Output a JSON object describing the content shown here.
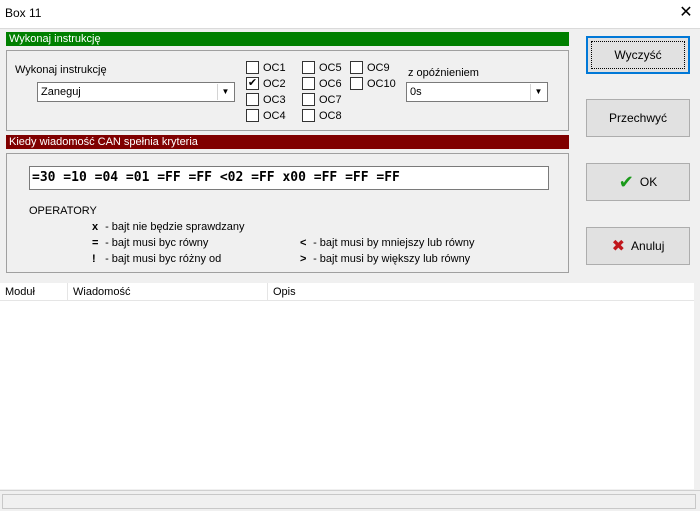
{
  "window": {
    "title": "Box 11"
  },
  "execute_section": {
    "header": "Wykonaj instrukcję",
    "instruction_label": "Wykonaj instrukcję",
    "instruction_value": "Zaneguj",
    "oc_columns": [
      [
        {
          "label": "OC1",
          "checked": false
        },
        {
          "label": "OC2",
          "checked": true
        },
        {
          "label": "OC3",
          "checked": false
        },
        {
          "label": "OC4",
          "checked": false
        }
      ],
      [
        {
          "label": "OC5",
          "checked": false
        },
        {
          "label": "OC6",
          "checked": false
        },
        {
          "label": "OC7",
          "checked": false
        },
        {
          "label": "OC8",
          "checked": false
        }
      ],
      [
        {
          "label": "OC9",
          "checked": false
        },
        {
          "label": "OC10",
          "checked": false
        }
      ]
    ],
    "delay_label": "z opóźnieniem",
    "delay_value": "0s"
  },
  "criteria_section": {
    "header": "Kiedy wiadomość CAN spełnia kryteria",
    "criteria": "=30 =10 =04 =01 =FF =FF <02 =FF x00 =FF =FF =FF",
    "operators_title": "OPERATORY",
    "operators_left": [
      {
        "symbol": "x",
        "text": "bajt nie będzie sprawdzany"
      },
      {
        "symbol": "=",
        "text": "bajt musi byc równy"
      },
      {
        "symbol": "!",
        "text": "bajt musi byc różny od"
      }
    ],
    "operators_right": [
      {
        "symbol": "<",
        "text": "bajt musi by mniejszy lub równy"
      },
      {
        "symbol": ">",
        "text": "bajt musi by większy lub równy"
      }
    ]
  },
  "buttons": {
    "clear": "Wyczyść",
    "capture": "Przechwyć",
    "ok": "OK",
    "cancel": "Anuluj"
  },
  "list": {
    "columns": [
      "Moduł",
      "Wiadomość",
      "Opis"
    ]
  },
  "colors": {
    "execute_header": "#008000",
    "criteria_header": "#800000",
    "ok_check": "#1a9a1a",
    "cancel_x": "#c0161b",
    "default_button_border": "#0078d7"
  }
}
